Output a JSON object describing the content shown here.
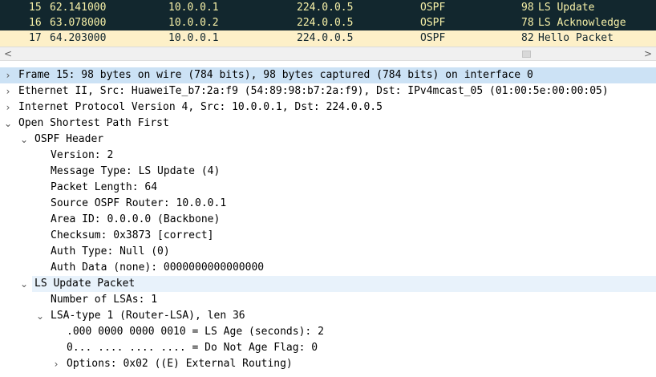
{
  "packet_list": {
    "rows": [
      {
        "no": "15",
        "time": "62.141000",
        "source": "10.0.0.1",
        "destination": "224.0.0.5",
        "protocol": "OSPF",
        "length": "98",
        "info": "LS Update"
      },
      {
        "no": "16",
        "time": "63.078000",
        "source": "10.0.0.2",
        "destination": "224.0.0.5",
        "protocol": "OSPF",
        "length": "78",
        "info": "LS Acknowledge"
      },
      {
        "no": "17",
        "time": "64.203000",
        "source": "10.0.0.1",
        "destination": "224.0.0.5",
        "protocol": "OSPF",
        "length": "82",
        "info": "Hello Packet"
      }
    ],
    "scrollbar": {
      "left_arrow": "<",
      "right_arrow": ">"
    }
  },
  "details": {
    "toggle_icons": {
      "collapsed": "chevron-right-icon",
      "expanded": "chevron-down-icon"
    },
    "frame": "Frame 15: 98 bytes on wire (784 bits), 98 bytes captured (784 bits) on interface 0",
    "ethernet": "Ethernet II, Src: HuaweiTe_b7:2a:f9 (54:89:98:b7:2a:f9), Dst: IPv4mcast_05 (01:00:5e:00:00:05)",
    "ip": "Internet Protocol Version 4, Src: 10.0.0.1, Dst: 224.0.0.5",
    "ospf": "Open Shortest Path First",
    "ospf_header": {
      "label": "OSPF Header",
      "version": "Version: 2",
      "message_type": "Message Type: LS Update (4)",
      "packet_length": "Packet Length: 64",
      "source_router": "Source OSPF Router: 10.0.0.1",
      "area_id": "Area ID: 0.0.0.0 (Backbone)",
      "checksum": "Checksum: 0x3873 [correct]",
      "auth_type": "Auth Type: Null (0)",
      "auth_data": "Auth Data (none): 0000000000000000"
    },
    "ls_update": {
      "label": "LS Update Packet",
      "num_lsas": "Number of LSAs: 1",
      "lsa": {
        "label": "LSA-type 1 (Router-LSA), len 36",
        "ls_age": ".000 0000 0000 0010 = LS Age (seconds): 2",
        "do_not_age": "0... .... .... .... = Do Not Age Flag: 0",
        "options": "Options: 0x02 ((E) External Routing)"
      }
    }
  },
  "colors": {
    "row_dark_bg": "#12272e",
    "row_dark_fg": "#f7f1a8",
    "row_light_bg": "#fdf0c8",
    "selected_bg": "#cce2f5",
    "highlight_bg": "#e8f2fb"
  }
}
